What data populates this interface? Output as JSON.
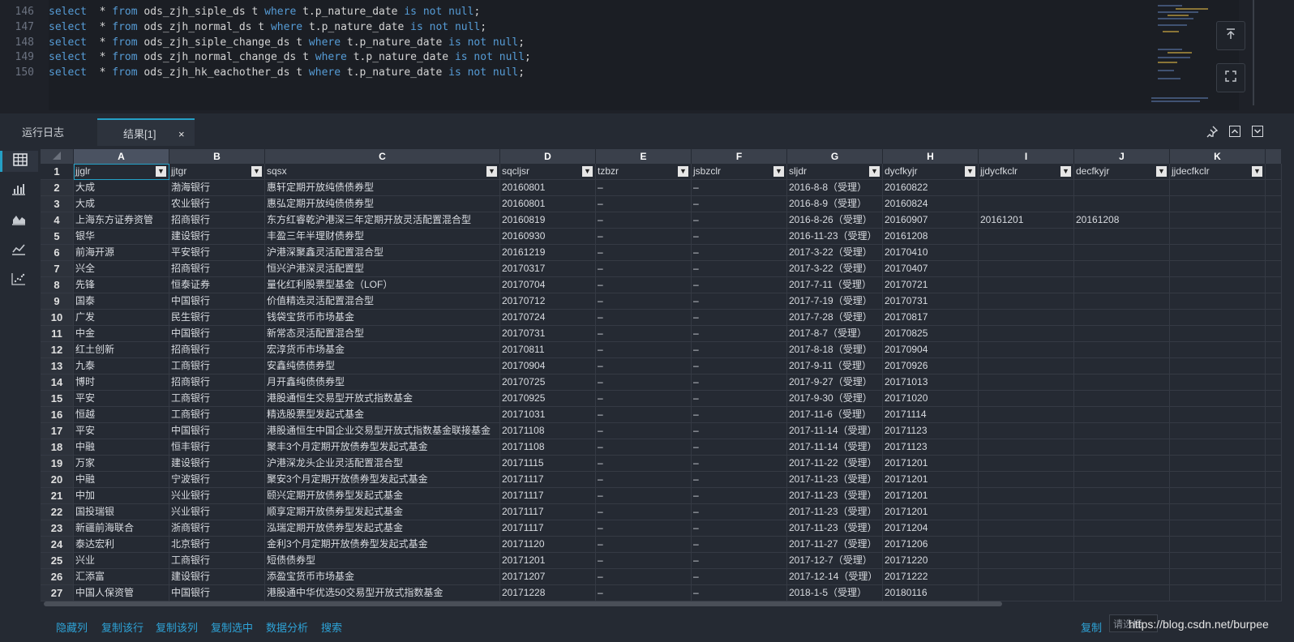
{
  "editor": {
    "line_numbers": [
      "146",
      "147",
      "148",
      "149",
      "150"
    ],
    "lines": [
      [
        "select",
        "* from",
        "ods_zjh_siple_ds t",
        "where",
        "t.p_nature_date",
        "is not null",
        ";"
      ],
      [
        "select",
        "* from",
        "ods_zjh_normal_ds t",
        "where",
        "t.p_nature_date",
        "is not null",
        ";"
      ],
      [
        "select",
        "* from",
        "ods_zjh_siple_change_ds t",
        "where",
        "t.p_nature_date",
        "is not null",
        ";"
      ],
      [
        "select",
        "* from",
        "ods_zjh_normal_change_ds t",
        "where",
        "t.p_nature_date",
        "is not null",
        ";"
      ],
      [
        "select",
        "* from",
        "ods_zjh_hk_eachother_ds t",
        "where",
        "t.p_nature_date",
        "is not null",
        ";"
      ]
    ],
    "side_buttons": [
      "scroll-top-icon",
      "fullscreen-icon"
    ]
  },
  "tabs": {
    "log_label": "运行日志",
    "result_label": "结果[1]",
    "close_glyph": "×"
  },
  "toolbar_right": [
    "pin-icon",
    "collapse-up-icon",
    "collapse-down-icon"
  ],
  "left_tools": [
    "table-icon",
    "bar-chart-icon",
    "area-chart-icon",
    "line-chart-icon",
    "scatter-chart-icon"
  ],
  "grid": {
    "col_letters": [
      "A",
      "B",
      "C",
      "D",
      "E",
      "F",
      "G",
      "H",
      "I",
      "J",
      "K"
    ],
    "headers": [
      "jjglr",
      "jjtgr",
      "sqsx",
      "sqcljsr",
      "tzbzr",
      "jsbzclr",
      "sljdr",
      "dycfkyjr",
      "jjdycfkclr",
      "decfkyjr",
      "jjdecfkclr"
    ],
    "rows": [
      [
        "2",
        "大成",
        "渤海银行",
        "惠轩定期开放纯债债券型",
        "20160801",
        "–",
        "–",
        "2016-8-8（受理）",
        "20160822",
        "",
        "",
        ""
      ],
      [
        "3",
        "大成",
        "农业银行",
        "惠弘定期开放纯债债券型",
        "20160801",
        "–",
        "–",
        "2016-8-9（受理）",
        "20160824",
        "",
        "",
        ""
      ],
      [
        "4",
        "上海东方证券资管",
        "招商银行",
        "东方红睿乾沪港深三年定期开放灵活配置混合型",
        "20160819",
        "–",
        "–",
        "2016-8-26（受理）",
        "20160907",
        "20161201",
        "20161208",
        ""
      ],
      [
        "5",
        "银华",
        "建设银行",
        "丰盈三年半理财债券型",
        "20160930",
        "–",
        "–",
        "2016-11-23（受理）",
        "20161208",
        "",
        "",
        ""
      ],
      [
        "6",
        "前海开源",
        "平安银行",
        "沪港深聚鑫灵活配置混合型",
        "20161219",
        "–",
        "–",
        "2017-3-22（受理）",
        "20170410",
        "",
        "",
        ""
      ],
      [
        "7",
        "兴全",
        "招商银行",
        "恒兴沪港深灵活配置型",
        "20170317",
        "–",
        "–",
        "2017-3-22（受理）",
        "20170407",
        "",
        "",
        ""
      ],
      [
        "8",
        "先锋",
        "恒泰证券",
        "量化红利股票型基金（LOF）",
        "20170704",
        "–",
        "–",
        "2017-7-11（受理）",
        "20170721",
        "",
        "",
        ""
      ],
      [
        "9",
        "国泰",
        "中国银行",
        "价值精选灵活配置混合型",
        "20170712",
        "–",
        "–",
        "2017-7-19（受理）",
        "20170731",
        "",
        "",
        ""
      ],
      [
        "10",
        "广发",
        "民生银行",
        "钱袋宝货币市场基金",
        "20170724",
        "–",
        "–",
        "2017-7-28（受理）",
        "20170817",
        "",
        "",
        ""
      ],
      [
        "11",
        "中金",
        "中国银行",
        "新常态灵活配置混合型",
        "20170731",
        "–",
        "–",
        "2017-8-7（受理）",
        "20170825",
        "",
        "",
        ""
      ],
      [
        "12",
        "红土创新",
        "招商银行",
        "宏淳货币市场基金",
        "20170811",
        "–",
        "–",
        "2017-8-18（受理）",
        "20170904",
        "",
        "",
        ""
      ],
      [
        "13",
        "九泰",
        "工商银行",
        "安鑫纯债债券型",
        "20170904",
        "–",
        "–",
        "2017-9-11（受理）",
        "20170926",
        "",
        "",
        ""
      ],
      [
        "14",
        "博时",
        "招商银行",
        "月开鑫纯债债券型",
        "20170725",
        "–",
        "–",
        "2017-9-27（受理）",
        "20171013",
        "",
        "",
        ""
      ],
      [
        "15",
        "平安",
        "工商银行",
        "港股通恒生交易型开放式指数基金",
        "20170925",
        "–",
        "–",
        "2017-9-30（受理）",
        "20171020",
        "",
        "",
        ""
      ],
      [
        "16",
        "恒越",
        "工商银行",
        "精选股票型发起式基金",
        "20171031",
        "–",
        "–",
        "2017-11-6（受理）",
        "20171114",
        "",
        "",
        ""
      ],
      [
        "17",
        "平安",
        "中国银行",
        "港股通恒生中国企业交易型开放式指数基金联接基金",
        "20171108",
        "–",
        "–",
        "2017-11-14（受理）",
        "20171123",
        "",
        "",
        ""
      ],
      [
        "18",
        "中融",
        "恒丰银行",
        "聚丰3个月定期开放债券型发起式基金",
        "20171108",
        "–",
        "–",
        "2017-11-14（受理）",
        "20171123",
        "",
        "",
        ""
      ],
      [
        "19",
        "万家",
        "建设银行",
        "沪港深龙头企业灵活配置混合型",
        "20171115",
        "–",
        "–",
        "2017-11-22（受理）",
        "20171201",
        "",
        "",
        ""
      ],
      [
        "20",
        "中融",
        "宁波银行",
        "聚安3个月定期开放债券型发起式基金",
        "20171117",
        "–",
        "–",
        "2017-11-23（受理）",
        "20171201",
        "",
        "",
        ""
      ],
      [
        "21",
        "中加",
        "兴业银行",
        "颐兴定期开放债券型发起式基金",
        "20171117",
        "–",
        "–",
        "2017-11-23（受理）",
        "20171201",
        "",
        "",
        ""
      ],
      [
        "22",
        "国投瑞银",
        "兴业银行",
        "顺享定期开放债券型发起式基金",
        "20171117",
        "–",
        "–",
        "2017-11-23（受理）",
        "20171201",
        "",
        "",
        ""
      ],
      [
        "23",
        "新疆前海联合",
        "浙商银行",
        "泓瑞定期开放债券型发起式基金",
        "20171117",
        "–",
        "–",
        "2017-11-23（受理）",
        "20171204",
        "",
        "",
        ""
      ],
      [
        "24",
        "泰达宏利",
        "北京银行",
        "金利3个月定期开放债券型发起式基金",
        "20171120",
        "–",
        "–",
        "2017-11-27（受理）",
        "20171206",
        "",
        "",
        ""
      ],
      [
        "25",
        "兴业",
        "工商银行",
        "短债债券型",
        "20171201",
        "–",
        "–",
        "2017-12-7（受理）",
        "20171220",
        "",
        "",
        ""
      ],
      [
        "26",
        "汇添富",
        "建设银行",
        "添盈宝货币市场基金",
        "20171207",
        "–",
        "–",
        "2017-12-14（受理）",
        "20171222",
        "",
        "",
        ""
      ],
      [
        "27",
        "中国人保资管",
        "中国银行",
        "港股通中华优选50交易型开放式指数基金",
        "20171228",
        "–",
        "–",
        "2018-1-5（受理）",
        "20180116",
        "",
        "",
        ""
      ]
    ]
  },
  "bottom": {
    "actions": [
      "隐藏列",
      "复制该行",
      "复制该列",
      "复制选中",
      "数据分析",
      "搜索"
    ],
    "copy_label": "复制",
    "search_placeholder": "请选择",
    "watermark": "https://blog.csdn.net/burpee"
  }
}
